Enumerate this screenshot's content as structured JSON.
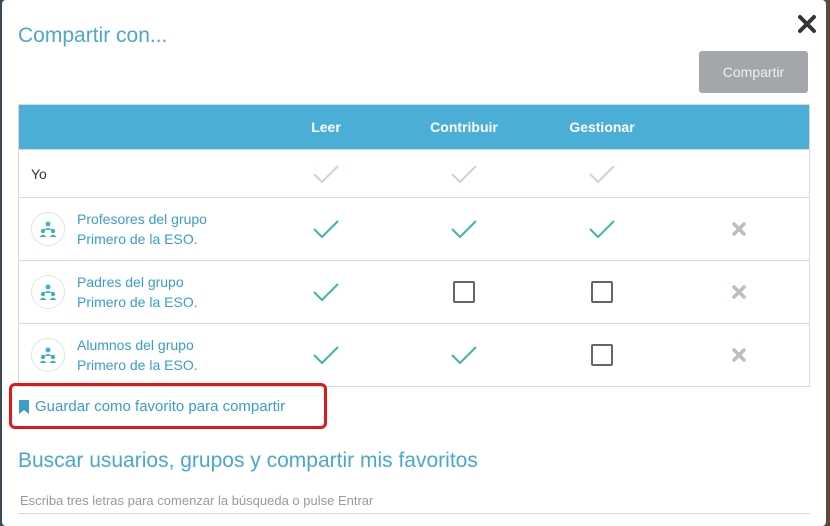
{
  "modal": {
    "title": "Compartir con...",
    "share_button": "Compartir"
  },
  "table": {
    "headers": [
      "Leer",
      "Contribuir",
      "Gestionar"
    ],
    "rows": [
      {
        "name": "Yo",
        "leer": "check-disabled",
        "contribuir": "check-disabled",
        "gestionar": "check-disabled",
        "removable": false
      },
      {
        "name_line1": "Profesores del grupo",
        "name_line2": "Primero de la ESO.",
        "leer": "check",
        "contribuir": "check",
        "gestionar": "check",
        "removable": true
      },
      {
        "name_line1": "Padres del grupo",
        "name_line2": "Primero de la ESO.",
        "leer": "check",
        "contribuir": "unchecked",
        "gestionar": "unchecked",
        "removable": true
      },
      {
        "name_line1": "Alumnos del grupo",
        "name_line2": "Primero de la ESO.",
        "leer": "check",
        "contribuir": "check",
        "gestionar": "unchecked",
        "removable": true
      }
    ]
  },
  "favorite_link": "Guardar como favorito para compartir",
  "search": {
    "title": "Buscar usuarios, grupos y compartir mis favoritos",
    "placeholder": "Escriba tres letras para comenzar la búsqueda o pulse Entrar"
  },
  "colors": {
    "accent": "#4aa8cc",
    "header_bg": "#4aaed7",
    "check": "#3fb5a8",
    "check_disabled": "#cfd3d6",
    "highlight": "#e01818"
  },
  "icons": {
    "close": "close-icon",
    "group_avatar": "group-icon",
    "bookmark": "bookmark-icon",
    "remove": "remove-icon",
    "check": "check-icon"
  }
}
